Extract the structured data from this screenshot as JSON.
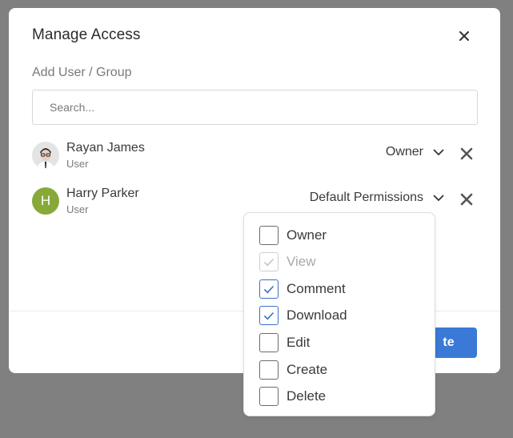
{
  "modal": {
    "title": "Manage Access",
    "close_icon": "close-icon"
  },
  "add_section": {
    "label": "Add User / Group",
    "search_placeholder": "Search..."
  },
  "users": [
    {
      "name": "Rayan James",
      "role": "User",
      "permission": "Owner",
      "avatar": "photo"
    },
    {
      "name": "Harry Parker",
      "role": "User",
      "permission": "Default Permissions",
      "avatar_initial": "H",
      "avatar_color": "#86a93a"
    }
  ],
  "footer": {
    "primary_label_visible": "te",
    "primary_color": "#3a79d6"
  },
  "permissions_dropdown": {
    "options": [
      {
        "label": "Owner",
        "checked": false,
        "disabled": false
      },
      {
        "label": "View",
        "checked": true,
        "disabled": true
      },
      {
        "label": "Comment",
        "checked": true,
        "disabled": false
      },
      {
        "label": "Download",
        "checked": true,
        "disabled": false
      },
      {
        "label": "Edit",
        "checked": false,
        "disabled": false
      },
      {
        "label": "Create",
        "checked": false,
        "disabled": false
      },
      {
        "label": "Delete",
        "checked": false,
        "disabled": false
      }
    ]
  },
  "colors": {
    "backdrop": "#808080",
    "checkbox_checked": "#3a70c8"
  }
}
